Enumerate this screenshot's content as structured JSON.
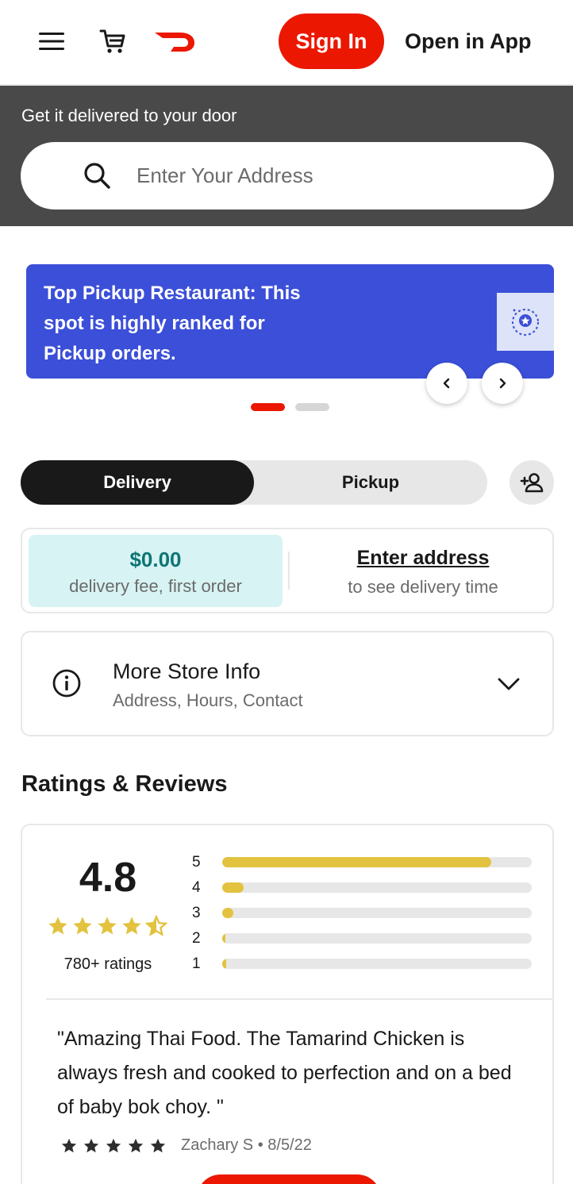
{
  "header": {
    "sign_in": "Sign In",
    "open_in_app": "Open in App",
    "accent": "#eb1700"
  },
  "address": {
    "title": "Get it delivered to your door",
    "placeholder": "Enter Your Address"
  },
  "promo": {
    "text": "Top Pickup Restaurant: This spot is highly ranked for Pickup orders.",
    "color": "#3b4fd8",
    "slides": 2,
    "active_slide": 1
  },
  "fulfillment": {
    "options": [
      "Delivery",
      "Pickup"
    ],
    "selected": "Delivery"
  },
  "fee": {
    "amount": "$0.00",
    "description": "delivery fee, first order",
    "enter_address": "Enter address",
    "delivery_time_hint": "to see delivery time"
  },
  "store_info": {
    "title": "More Store Info",
    "subtitle": "Address, Hours, Contact"
  },
  "ratings": {
    "heading": "Ratings & Reviews",
    "average": "4.8",
    "stars_value": 4.5,
    "count": "780+ ratings",
    "distribution": [
      {
        "label": "5",
        "fraction": 0.87
      },
      {
        "label": "4",
        "fraction": 0.07
      },
      {
        "label": "3",
        "fraction": 0.035
      },
      {
        "label": "2",
        "fraction": 0.01
      },
      {
        "label": "1",
        "fraction": 0.013
      }
    ],
    "review": {
      "text": "\"Amazing Thai Food. The Tamarind Chicken is always fresh and cooked to perfection and on a bed of baby bok choy. \"",
      "stars": 5,
      "author": "Zachary S • 8/5/22"
    }
  }
}
